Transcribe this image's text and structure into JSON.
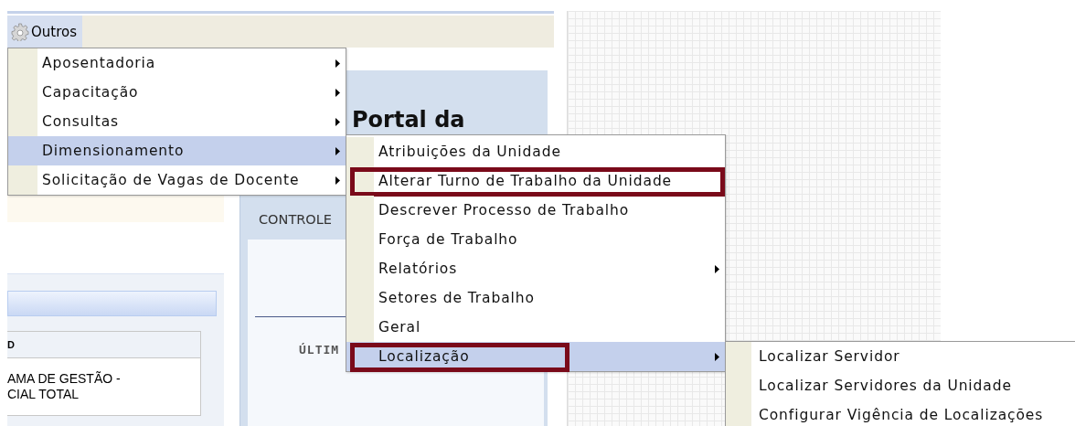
{
  "toolbar": {
    "menu": {
      "label": "Outros",
      "selected": true
    }
  },
  "main_menu": [
    {
      "label": "Aposentadoria",
      "has_submenu": true,
      "selected": false,
      "highlighted": false
    },
    {
      "label": "Capacitação",
      "has_submenu": true,
      "selected": false,
      "highlighted": false
    },
    {
      "label": "Consultas",
      "has_submenu": true,
      "selected": false,
      "highlighted": false
    },
    {
      "label": "Dimensionamento",
      "has_submenu": true,
      "selected": true,
      "highlighted": false
    },
    {
      "label": "Solicitação de Vagas de Docente",
      "has_submenu": true,
      "selected": false,
      "highlighted": false
    }
  ],
  "submenu": [
    {
      "label": "Atribuições da Unidade",
      "has_submenu": false,
      "selected": false,
      "highlighted": false
    },
    {
      "label": "Alterar Turno de Trabalho da Unidade",
      "has_submenu": false,
      "selected": false,
      "highlighted": true
    },
    {
      "label": "Descrever Processo de Trabalho",
      "has_submenu": false,
      "selected": false,
      "highlighted": false
    },
    {
      "label": "Força de Trabalho",
      "has_submenu": false,
      "selected": false,
      "highlighted": false
    },
    {
      "label": "Relatórios",
      "has_submenu": true,
      "selected": false,
      "highlighted": false
    },
    {
      "label": "Setores de Trabalho",
      "has_submenu": false,
      "selected": false,
      "highlighted": false
    },
    {
      "label": "Geral",
      "has_submenu": false,
      "selected": false,
      "highlighted": false
    },
    {
      "label": "Localização",
      "has_submenu": true,
      "selected": true,
      "highlighted": true
    }
  ],
  "localizacao_submenu": [
    {
      "label": "Localizar Servidor",
      "has_submenu": false,
      "selected": false,
      "highlighted": false
    },
    {
      "label": "Localizar Servidores da Unidade",
      "has_submenu": false,
      "selected": false,
      "highlighted": false
    },
    {
      "label": "Configurar Vigência de Localizações",
      "has_submenu": false,
      "selected": false,
      "highlighted": false
    }
  ],
  "portal_title": "Portal da",
  "panel_text": "CONTROLE",
  "section_heading": "ÚLTIM",
  "table": {
    "columns": [
      "D"
    ],
    "rows": [
      [
        "AMA DE GESTÃO -\nCIAL TOTAL"
      ]
    ]
  }
}
